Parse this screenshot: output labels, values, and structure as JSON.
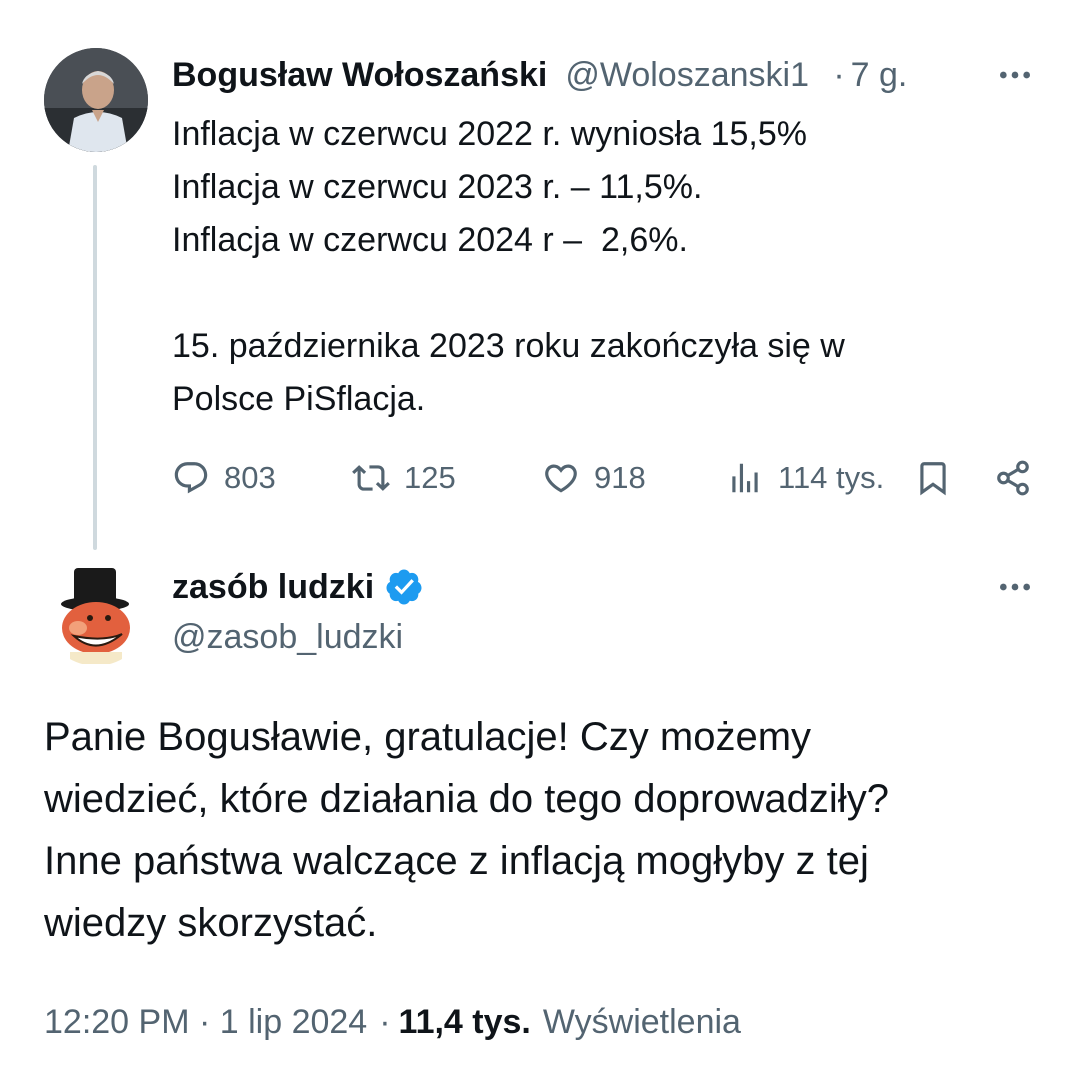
{
  "original_tweet": {
    "author_name": "Bogusław Wołoszański",
    "handle": "@Woloszanski1",
    "separator": "·",
    "time_ago": "7 g.",
    "text": "Inflacja w czerwcu 2022 r. wyniosła 15,5%\nInflacja w czerwcu 2023 r. – 11,5%.\nInflacja w czerwcu 2024 r –  2,6%.\n\n15. października 2023 roku zakończyła się w\nPolsce PiSflacja.",
    "replies": "803",
    "retweets": "125",
    "likes": "918",
    "views": "114 tys.",
    "icons": [
      "reply-icon",
      "retweet-icon",
      "like-icon",
      "views-icon",
      "bookmark-icon",
      "share-icon",
      "more-icon"
    ]
  },
  "reply_tweet": {
    "author_name": "zasób ludzki",
    "verified": true,
    "handle": "@zasob_ludzki",
    "text": "Panie Bogusławie, gratulacje! Czy możemy\nwiedzieć, które działania do tego doprowadziły?\nInne państwa walczące z inflacją mogłyby z tej\nwiedzy skorzystać.",
    "timestamp": "12:20 PM · 1 lip 2024",
    "separator": "·",
    "views_count": "11,4 tys.",
    "views_label": "Wyświetlenia"
  },
  "colors": {
    "text_primary": "#0f1419",
    "text_secondary": "#536471",
    "thread_line": "#cfd9de",
    "verified_blue": "#1d9bf0"
  }
}
